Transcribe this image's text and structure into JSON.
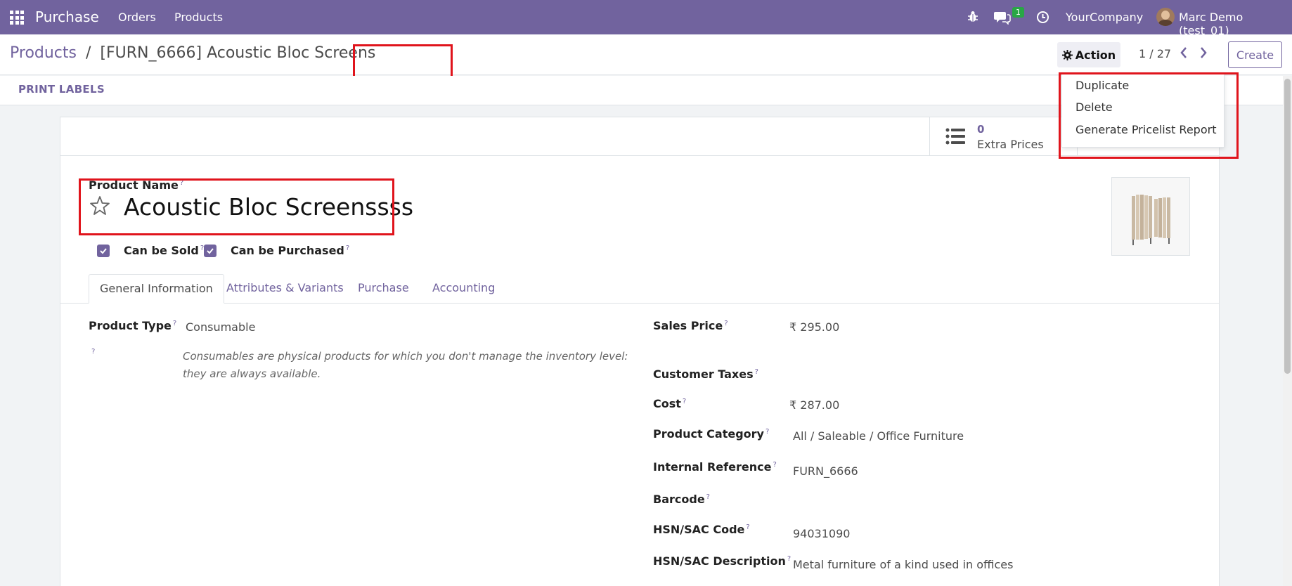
{
  "navbar": {
    "brand": "Purchase",
    "menu": [
      "Orders",
      "Products"
    ],
    "chat_count": "1",
    "company": "YourCompany",
    "user": "Marc Demo (test_01)"
  },
  "breadcrumb": {
    "parent": "Products",
    "separator": "/",
    "current": "[FURN_6666] Acoustic Bloc Screens"
  },
  "control": {
    "action_label": "Action",
    "pager": "1 / 27",
    "create_label": "Create"
  },
  "statusbar": {
    "print_labels": "PRINT LABELS"
  },
  "action_menu": {
    "items": [
      "Duplicate",
      "Delete",
      "Generate Pricelist Report"
    ]
  },
  "smart_buttons": {
    "extra_prices_value": "0",
    "extra_prices_label": "Extra Prices"
  },
  "form": {
    "product_name_label": "Product Name",
    "product_name": "Acoustic Bloc Screenssss",
    "can_be_sold_label": "Can be Sold",
    "can_be_purchased_label": "Can be Purchased",
    "help_mark": "?",
    "tabs": [
      "General Information",
      "Attributes & Variants",
      "Purchase",
      "Accounting"
    ],
    "product_type_label": "Product Type",
    "product_type": "Consumable",
    "product_type_help": "Consumables are physical products for which you don't manage the inventory level: they are always available.",
    "sales_price_label": "Sales Price",
    "sales_price": "₹ 295.00",
    "customer_taxes_label": "Customer Taxes",
    "cost_label": "Cost",
    "cost": "₹ 287.00",
    "product_category_label": "Product Category",
    "product_category": "All / Saleable / Office Furniture",
    "internal_reference_label": "Internal Reference",
    "internal_reference": "FURN_6666",
    "barcode_label": "Barcode",
    "hsn_code_label": "HSN/SAC Code",
    "hsn_code": "94031090",
    "hsn_description_label": "HSN/SAC Description",
    "hsn_description": "Metal furniture of a kind used in offices"
  },
  "colors": {
    "brand": "#71639e",
    "highlight": "#e0141c",
    "badge": "#28a745"
  }
}
